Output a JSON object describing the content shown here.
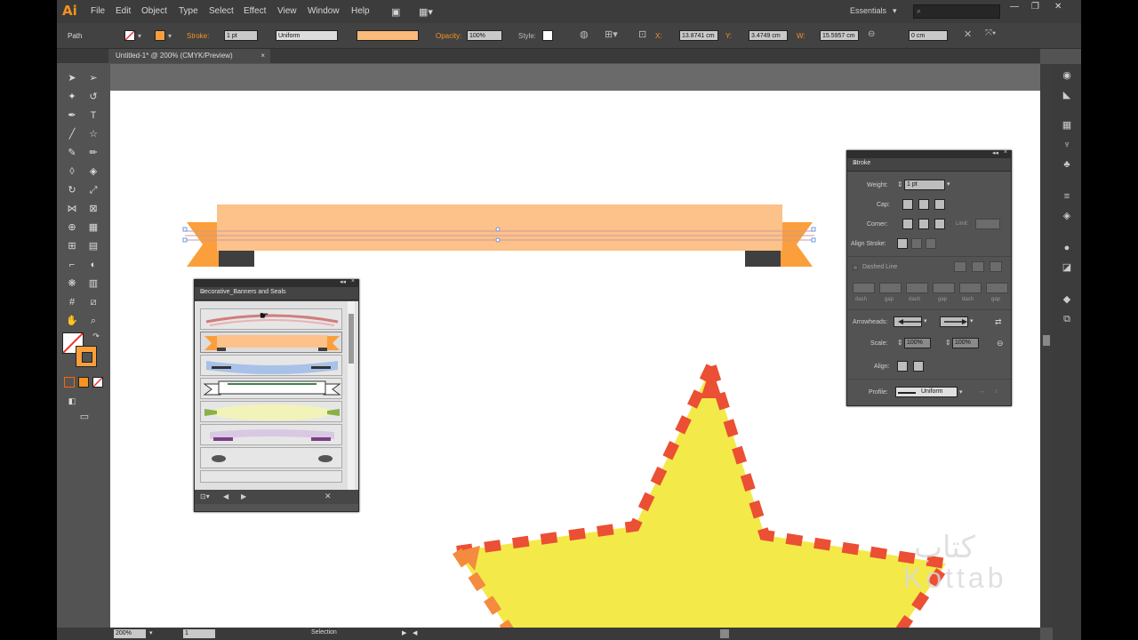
{
  "app": {
    "logo": "Ai"
  },
  "menus": [
    "File",
    "Edit",
    "Object",
    "Type",
    "Select",
    "Effect",
    "View",
    "Window",
    "Help"
  ],
  "workspace": "Essentials",
  "window_controls": [
    "—",
    "❐",
    "✕"
  ],
  "control_bar": {
    "selection": "Path",
    "stroke_label": "Stroke:",
    "stroke_weight": "1 pt",
    "profile": "Uniform",
    "opacity_label": "Opacity:",
    "opacity_value": "100%",
    "style_label": "Style:",
    "x_label": "X:",
    "x_value": "13.8741 cm",
    "y_label": "Y:",
    "y_value": "3.4749 cm",
    "w_label": "W:",
    "w_value": "15.5957 cm",
    "h_value": "0 cm"
  },
  "document_tab": "Untitled-1* @ 200% (CMYK/Preview)",
  "status_bar": {
    "zoom": "200%",
    "page": "1",
    "mode": "Selection"
  },
  "library_panel": {
    "title": "Decorative_Banners and Seals"
  },
  "stroke_panel": {
    "title": "Stroke",
    "weight_label": "Weight:",
    "weight_value": "1 pt",
    "cap_label": "Cap:",
    "corner_label": "Corner:",
    "limit_label": "Limit:",
    "align_label": "Align Stroke:",
    "dashed_label": "Dashed Line",
    "dash_labels": [
      "dash",
      "gap",
      "dash",
      "gap",
      "dash",
      "gap"
    ],
    "arrowheads_label": "Arrowheads:",
    "scale_label": "Scale:",
    "scale_value_1": "100%",
    "scale_value_2": "100%",
    "align_arrow_label": "Align:",
    "profile_label": "Profile:",
    "profile_value": "Uniform"
  },
  "watermark": {
    "arabic": "كتاب",
    "latin": "Kottab"
  },
  "colors": {
    "banner": "#fdc18a",
    "banner_dark": "#fb9f3c",
    "banner_shadow": "#3f3f3f",
    "star_fill": "#f3ea4a",
    "star_dash": "#eb4f34",
    "star_dash_orange": "#f48b3f",
    "accent_orange": "#f7931e"
  }
}
